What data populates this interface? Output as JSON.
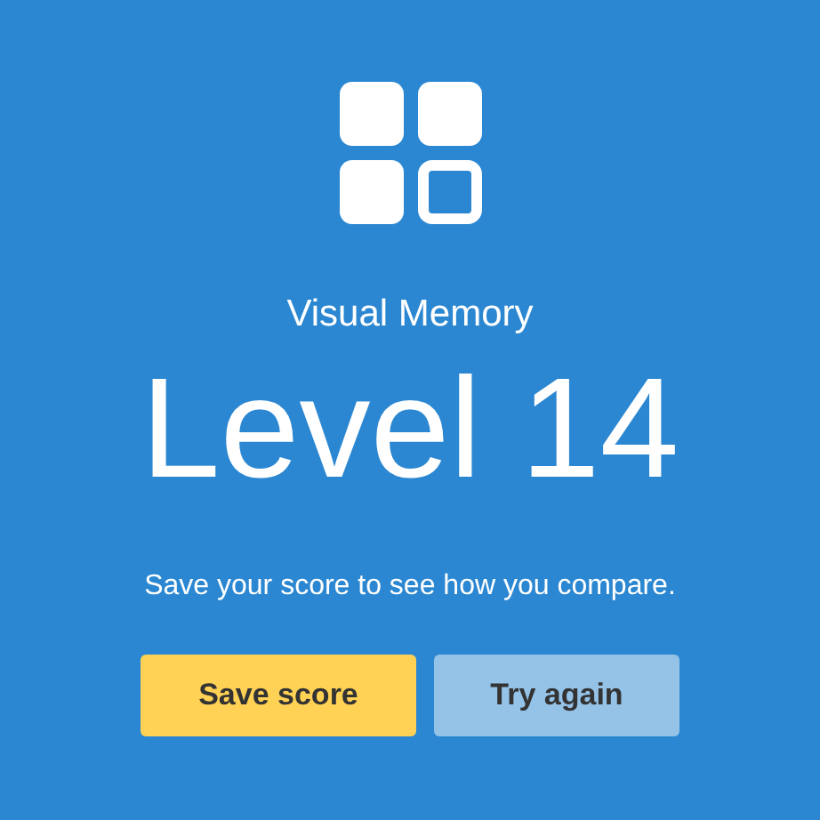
{
  "title": "Visual Memory",
  "result": "Level 14",
  "message": "Save your score to see how you compare.",
  "buttons": [
    {
      "label": "Save score",
      "kind": "primary"
    },
    {
      "label": "Try again",
      "kind": "secondary"
    }
  ]
}
